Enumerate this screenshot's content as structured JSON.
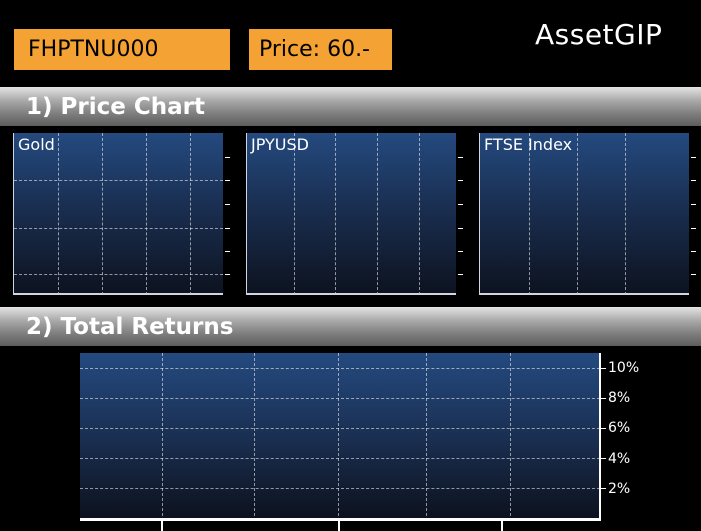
{
  "header": {
    "code": "FHPTNU000",
    "price": "Price: 60.-",
    "brand": "AssetGIP"
  },
  "sections": {
    "price_chart": "1) Price Chart",
    "total_returns": "2) Total Returns"
  },
  "chart_data": [
    {
      "type": "line",
      "title": "Gold",
      "series": []
    },
    {
      "type": "line",
      "title": "JPYUSD",
      "series": []
    },
    {
      "type": "line",
      "title": "FTSE Index",
      "series": []
    },
    {
      "type": "bar",
      "title": "",
      "yticks": [
        "10%",
        "8%",
        "6%",
        "4%",
        "2%"
      ],
      "ylim": [
        0,
        11
      ],
      "series": []
    }
  ],
  "colors": {
    "accent": "#f4a233",
    "plot_top": "#244a7f",
    "background": "#000000"
  }
}
